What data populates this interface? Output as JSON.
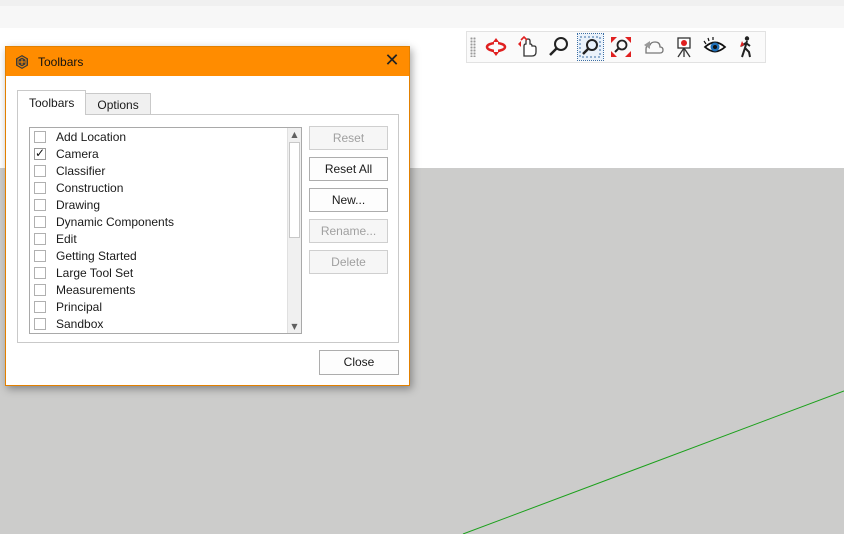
{
  "dialog": {
    "title": "Toolbars",
    "tabs": [
      {
        "label": "Toolbars",
        "selected": true
      },
      {
        "label": "Options",
        "selected": false
      }
    ],
    "toolbar_list": [
      {
        "label": "Add Location",
        "checked": false
      },
      {
        "label": "Camera",
        "checked": true
      },
      {
        "label": "Classifier",
        "checked": false
      },
      {
        "label": "Construction",
        "checked": false
      },
      {
        "label": "Drawing",
        "checked": false
      },
      {
        "label": "Dynamic Components",
        "checked": false
      },
      {
        "label": "Edit",
        "checked": false
      },
      {
        "label": "Getting Started",
        "checked": false
      },
      {
        "label": "Large Tool Set",
        "checked": false
      },
      {
        "label": "Measurements",
        "checked": false
      },
      {
        "label": "Principal",
        "checked": false
      },
      {
        "label": "Sandbox",
        "checked": false
      }
    ],
    "check_mark": "✓",
    "buttons": {
      "reset": "Reset",
      "reset_all": "Reset All",
      "new": "New...",
      "rename": "Rename...",
      "delete": "Delete"
    },
    "close_label": "Close",
    "close_glyph": "✕"
  },
  "camera_toolbar": {
    "tools": [
      {
        "icon": "orbit-icon"
      },
      {
        "icon": "pan-icon"
      },
      {
        "icon": "zoom-icon"
      },
      {
        "icon": "zoom-window-icon",
        "active": true
      },
      {
        "icon": "zoom-extents-icon"
      },
      {
        "icon": "previous-view-icon"
      },
      {
        "icon": "position-camera-icon"
      },
      {
        "icon": "look-around-icon"
      },
      {
        "icon": "walk-icon"
      }
    ]
  },
  "colors": {
    "dialog_title_bar": "#ff8c00",
    "viewport_background": "#cccccb",
    "green_axis": "#1aa01a",
    "tool_red": "#e02020"
  }
}
